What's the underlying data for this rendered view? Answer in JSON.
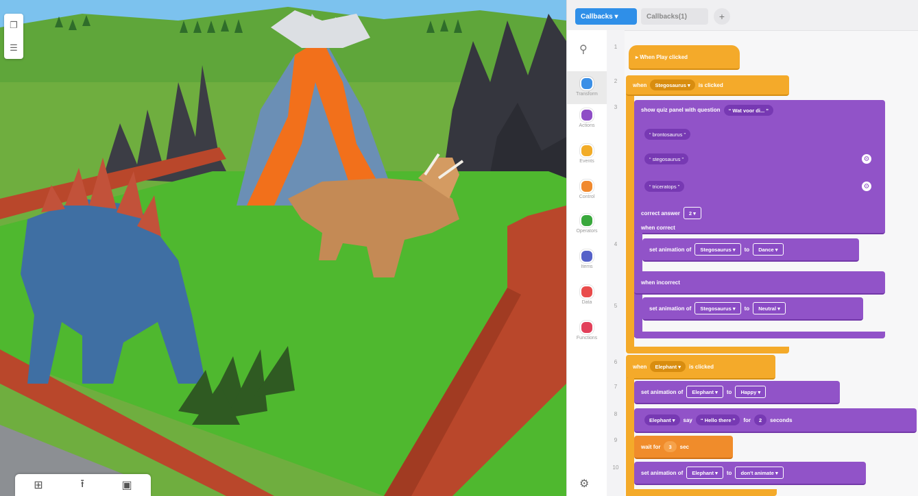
{
  "scene": {
    "colors": {
      "sky": "#7cc2ee",
      "grass": "#4fb82f",
      "fence": "#b9472b",
      "lava": "#f2701b",
      "rock": "#3f4048"
    },
    "corner_tools": [
      "window-icon",
      "list-icon"
    ],
    "bottom_toolbar": [
      {
        "icon": "grid-icon",
        "glyph": "⊞"
      },
      {
        "icon": "upload-icon",
        "glyph": "⭱"
      },
      {
        "icon": "gallery-icon",
        "glyph": "▣"
      }
    ]
  },
  "editor": {
    "tabs": [
      {
        "label": "Callbacks ▾",
        "active": true
      },
      {
        "label": "Callbacks(1)",
        "active": false
      }
    ],
    "add_tab": "+",
    "search_icon": "⚲",
    "categories": [
      {
        "label": "Transform",
        "color": "#3b8fe6",
        "selected": true
      },
      {
        "label": "Actions",
        "color": "#8e4dc6"
      },
      {
        "label": "Events",
        "color": "#f2ac28"
      },
      {
        "label": "Control",
        "color": "#f0892e"
      },
      {
        "label": "Operators",
        "color": "#39a83c"
      },
      {
        "label": "Items",
        "color": "#5561c8"
      },
      {
        "label": "Data",
        "color": "#e94b4b"
      },
      {
        "label": "Functions",
        "color": "#e2405a"
      }
    ],
    "settings_icon": "⚙",
    "line_numbers": [
      "1",
      "2",
      "3",
      "4",
      "5",
      "6",
      "7",
      "8",
      "9",
      "10"
    ],
    "code": {
      "when_play": "▸ When Play clicked",
      "when_clicked_1": {
        "pre": "when",
        "target": "Stegosaurus ▾",
        "post": "is clicked"
      },
      "quiz": {
        "label": "show quiz panel with question",
        "question": "“ Wat voor di... ”"
      },
      "options": [
        "“ brontosaurus ”",
        "“ stegosaurus ”",
        "“ triceratops ”"
      ],
      "correct_answer": {
        "label": "correct answer",
        "value": "2 ▾"
      },
      "when_correct": "when correct",
      "anim_correct": {
        "label": "set animation of",
        "target": "Stegosaurus ▾",
        "to": "to",
        "value": "Dance ▾"
      },
      "when_incorrect": "when incorrect",
      "anim_incorrect": {
        "label": "set animation of",
        "target": "Stegosaurus ▾",
        "to": "to",
        "value": "Neutral ▾"
      },
      "when_clicked_2": {
        "pre": "when",
        "target": "Elephant ▾",
        "post": "is clicked"
      },
      "anim_happy": {
        "label": "set animation of",
        "target": "Elephant ▾",
        "to": "to",
        "value": "Happy ▾"
      },
      "say": {
        "target": "Elephant ▾",
        "verb": "say",
        "text": "“ Hello there ”",
        "for": "for",
        "secs": "2",
        "unit": "seconds"
      },
      "wait": {
        "label": "wait for",
        "value": "3",
        "unit": "sec"
      },
      "anim_stop": {
        "label": "set animation of",
        "target": "Elephant ▾",
        "to": "to",
        "value": "don't animate ▾"
      }
    }
  }
}
